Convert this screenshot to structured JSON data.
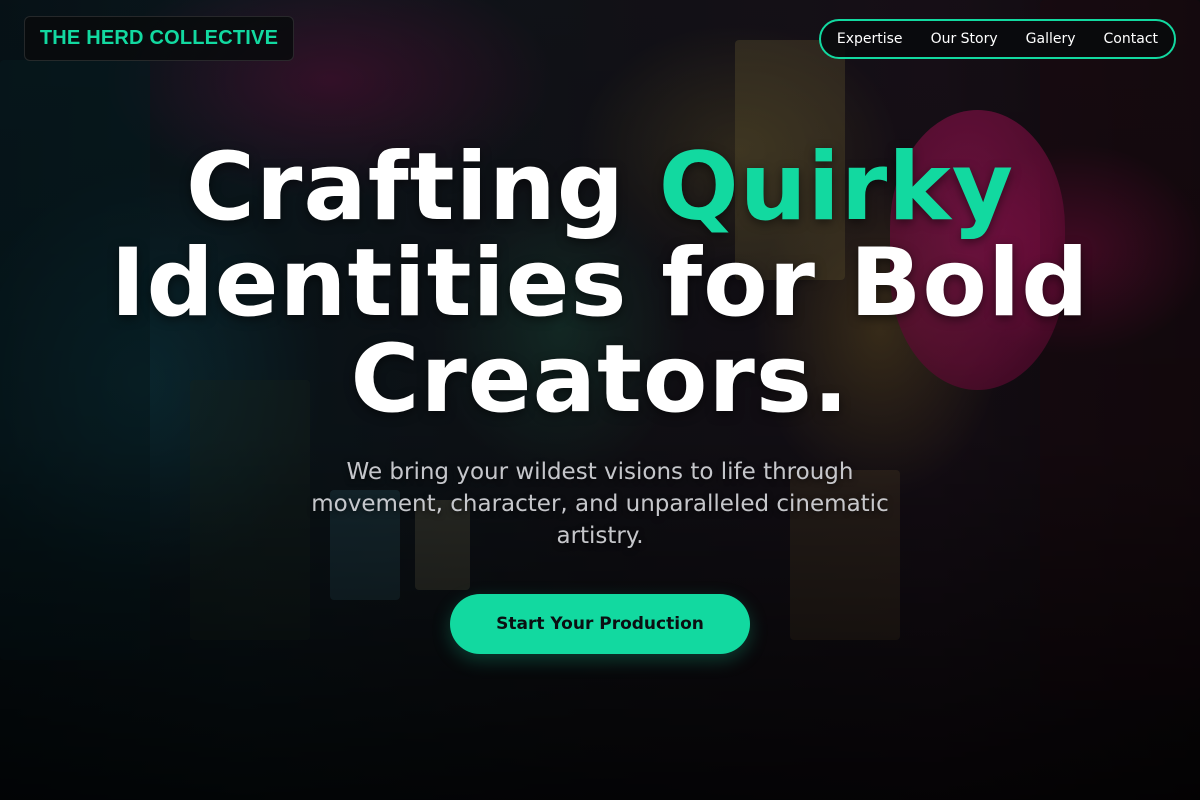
{
  "brand": {
    "name": "THE HERD COLLECTIVE"
  },
  "nav": {
    "items": [
      {
        "label": "Expertise"
      },
      {
        "label": "Our Story"
      },
      {
        "label": "Gallery"
      },
      {
        "label": "Contact"
      }
    ]
  },
  "hero": {
    "headline_part1": "Crafting ",
    "headline_accent": "Quirky",
    "headline_line2": "Identities for Bold",
    "headline_line3": "Creators.",
    "subtitle": "We bring your wildest visions to life through movement, character, and unparalleled cinematic artistry.",
    "cta_label": "Start Your Production",
    "background": "neon-alley-photo"
  },
  "colors": {
    "accent": "#12d9a0",
    "background": "#07090c",
    "text": "#ffffff"
  }
}
